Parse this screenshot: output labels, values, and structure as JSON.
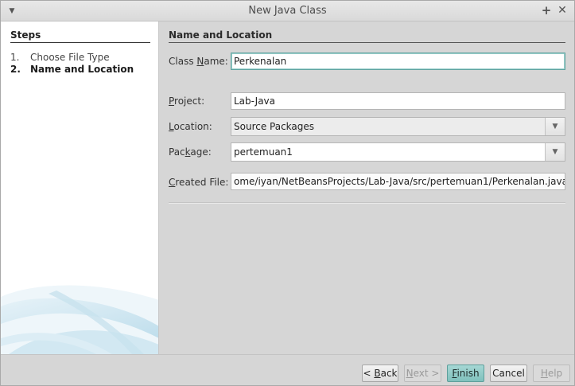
{
  "window": {
    "title": "New Java Class"
  },
  "steps": {
    "heading": "Steps",
    "items": [
      {
        "num": "1.",
        "label": "Choose File Type"
      },
      {
        "num": "2.",
        "label": "Name and Location"
      }
    ]
  },
  "form": {
    "section_title": "Name and Location",
    "class_name": {
      "label_pre": "Class ",
      "label_mnemonic": "N",
      "label_post": "ame:",
      "value": "Perkenalan"
    },
    "project": {
      "label_pre": "",
      "label_mnemonic": "P",
      "label_post": "roject:",
      "value": "Lab-Java"
    },
    "location": {
      "label_pre": "",
      "label_mnemonic": "L",
      "label_post": "ocation:",
      "value": "Source Packages"
    },
    "package": {
      "label_pre": "Pac",
      "label_mnemonic": "k",
      "label_post": "age:",
      "value": "pertemuan1"
    },
    "created_file": {
      "label_pre": "",
      "label_mnemonic": "C",
      "label_post": "reated File:",
      "value": "ome/iyan/NetBeansProjects/Lab-Java/src/pertemuan1/Perkenalan.java"
    }
  },
  "buttons": {
    "back": {
      "pre": "< ",
      "mn": "B",
      "post": "ack"
    },
    "next": {
      "pre": "",
      "mn": "N",
      "post": "ext >"
    },
    "finish": {
      "pre": "",
      "mn": "F",
      "post": "inish"
    },
    "cancel": {
      "label": "Cancel"
    },
    "help": {
      "pre": "",
      "mn": "H",
      "post": "elp"
    }
  },
  "icons": {
    "window_menu": "chevron-down-icon",
    "pin": "pin-icon",
    "close": "close-icon",
    "combo_arrow": "chevron-down-icon"
  },
  "colors": {
    "accent": "#7fc1bd",
    "focus_border": "#5fa3a0"
  }
}
